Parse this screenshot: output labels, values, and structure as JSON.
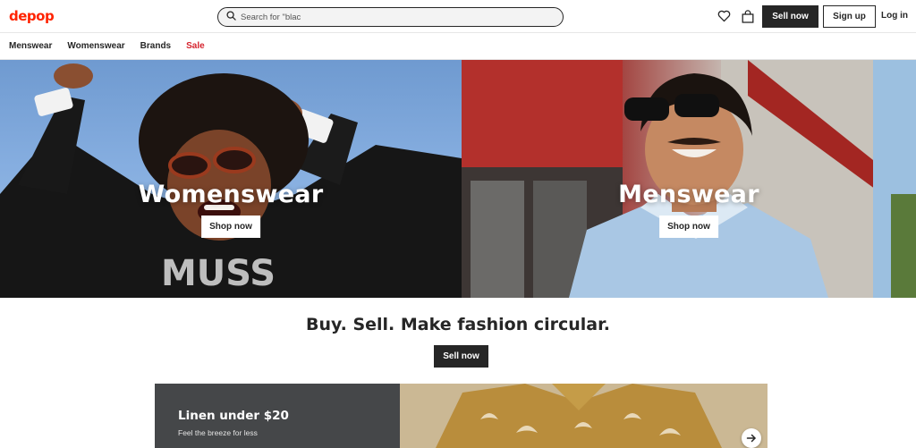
{
  "header": {
    "logo": "depop",
    "search_value": "Search for \"blac",
    "search_placeholder": "Search for \"blac",
    "sell_label": "Sell now",
    "signup_label": "Sign up",
    "login_label": "Log in",
    "icons": [
      "search-icon",
      "heart-icon",
      "bag-icon"
    ]
  },
  "nav": {
    "items": [
      {
        "label": "Menswear"
      },
      {
        "label": "Womenswear"
      },
      {
        "label": "Brands"
      },
      {
        "label": "Sale"
      }
    ]
  },
  "hero": {
    "left": {
      "title": "Womenswear",
      "button": "Shop now"
    },
    "right": {
      "title": "Menswear",
      "button": "Shop now"
    }
  },
  "main": {
    "tagline": "Buy. Sell. Make fashion circular.",
    "sell_label": "Sell now"
  },
  "promo": {
    "title": "Linen under $20",
    "subtitle": "Feel the breeze for less",
    "arrow_icon": "arrow-right-icon"
  },
  "colors": {
    "brand": "#ff2300",
    "sale": "#d5232d",
    "dark": "#262626",
    "promo_panel": "#454749"
  }
}
